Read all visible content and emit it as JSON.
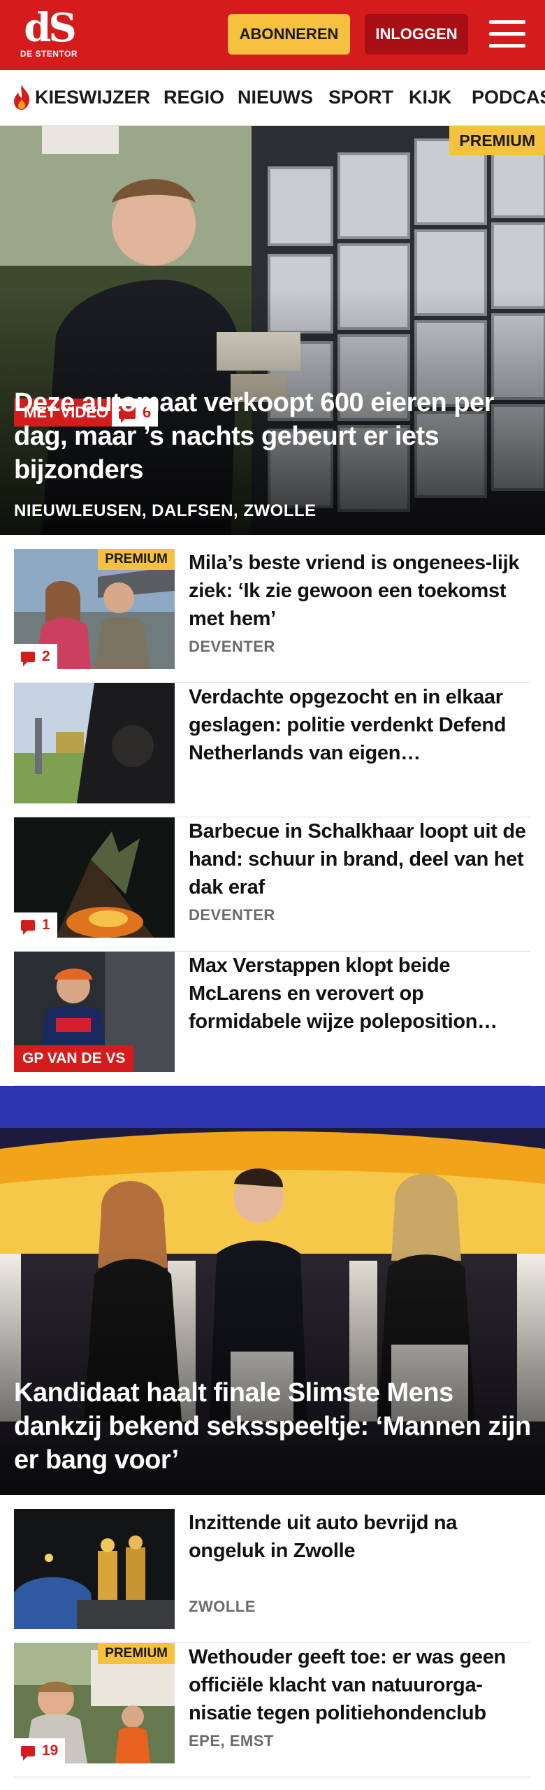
{
  "header": {
    "logo_mark": "dS",
    "logo_sub": "DE STENTOR",
    "subscribe_label": "ABONNEREN",
    "login_label": "INLOGGEN",
    "menu_icon": "hamburger-menu-icon",
    "brand_color": "#d51c1c",
    "accent_color": "#f6c13f"
  },
  "nav": {
    "items": [
      {
        "label": "KIESWIJZER",
        "icon": "flame-icon"
      },
      {
        "label": "REGIO"
      },
      {
        "label": "NIEUWS"
      },
      {
        "label": "SPORT"
      },
      {
        "label": "KIJK"
      },
      {
        "label": "PODCAS"
      }
    ]
  },
  "hero1": {
    "premium": "PREMIUM",
    "video_label": "MET VIDEO",
    "comments": "6",
    "title": "Deze automaat verkoopt 600 eieren per dag, maar ’s nachts gebeurt er iets bijzonders",
    "location": "NIEUWLEUSEN, DALFSEN, ZWOLLE"
  },
  "articles": [
    {
      "title": "Mila’s beste vriend is ongenees-lijk ziek: ‘Ik zie gewoon een toekomst met hem’",
      "location": "DEVENTER",
      "premium": "PREMIUM",
      "comments": "2"
    },
    {
      "title": "Verdachte opgezocht en in elkaar geslagen: politie verdenkt Defend Netherlands van eigen…"
    },
    {
      "title": "Barbecue in Schalkhaar loopt uit de hand: schuur in brand, deel van het dak eraf",
      "location": "DEVENTER",
      "comments": "1"
    },
    {
      "title": "Max Verstappen klopt beide McLarens en verovert op formidabele wijze poleposition…",
      "tag": "GP VAN DE VS"
    }
  ],
  "hero2": {
    "title": "Kandidaat haalt finale Slimste Mens dankzij bekend seksspeeltje: ‘Mannen zijn er bang voor’"
  },
  "articles2": [
    {
      "title": "Inzittende uit auto bevrijd na ongeluk in Zwolle",
      "location": "ZWOLLE"
    },
    {
      "title": "Wethouder geeft toe: er was geen officiële klacht van natuurorga-nisatie tegen politiehondenclub",
      "location": "EPE, EMST",
      "premium": "PREMIUM",
      "comments": "19"
    }
  ]
}
